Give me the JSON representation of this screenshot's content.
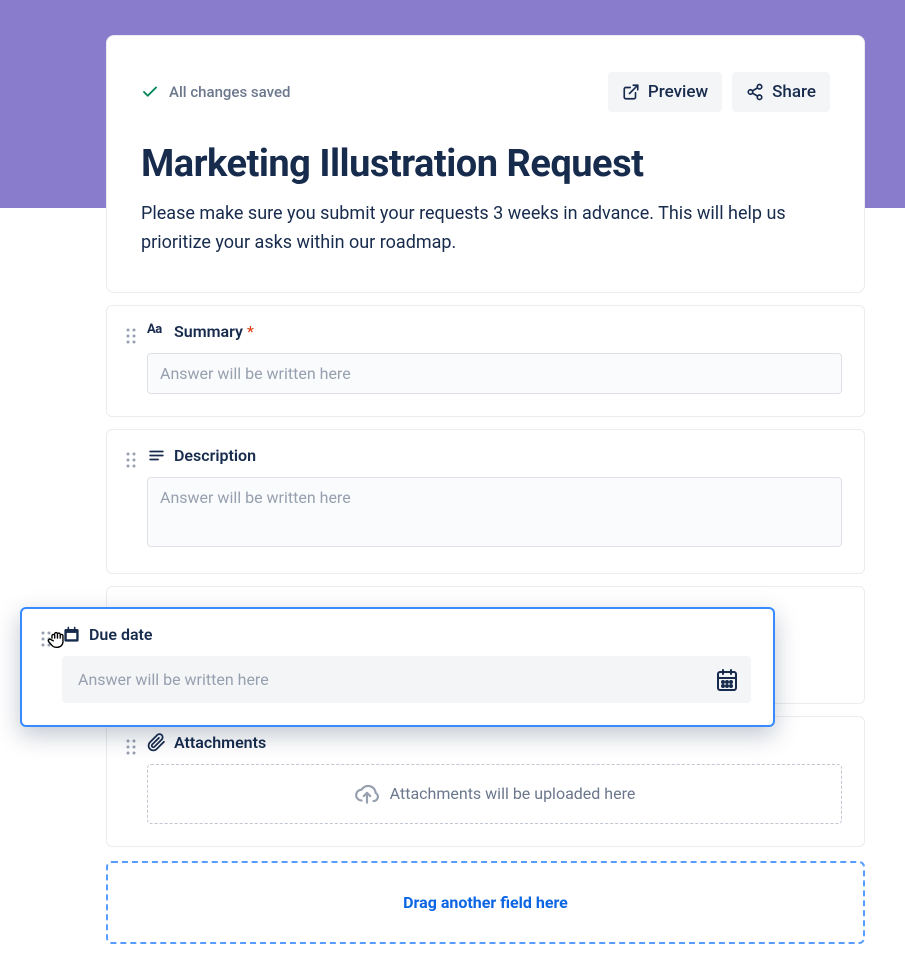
{
  "save_status": "All changes saved",
  "actions": {
    "preview": "Preview",
    "share": "Share"
  },
  "form": {
    "title": "Marketing Illustration Request",
    "description": "Please make sure you submit your requests 3 weeks in advance. This will help us prioritize your asks within our roadmap."
  },
  "fields": {
    "summary": {
      "label": "Summary",
      "required_marker": "*",
      "placeholder": "Answer will be written here"
    },
    "description": {
      "label": "Description",
      "placeholder": "Answer will be written here"
    },
    "due_date": {
      "label": "Due date",
      "placeholder": "Answer will be written here"
    },
    "attachments": {
      "label": "Attachments",
      "placeholder": "Attachments will be uploaded here"
    }
  },
  "dropzone": {
    "label": "Drag another field here"
  }
}
